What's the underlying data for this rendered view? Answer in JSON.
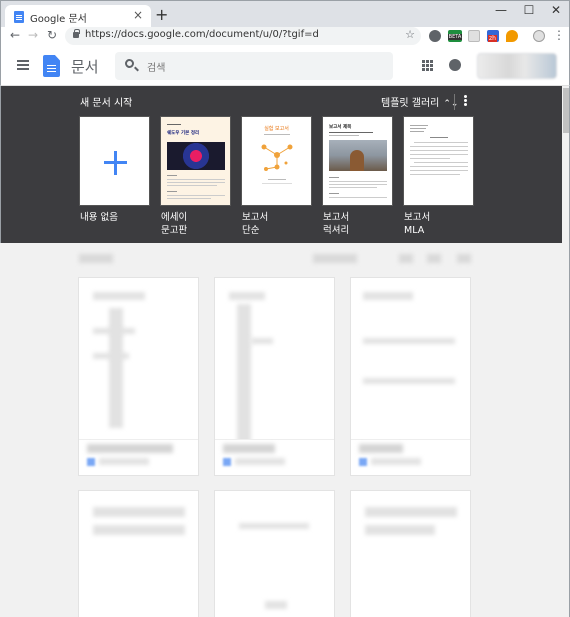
{
  "browser": {
    "tab_title": "Google 문서",
    "tab_close": "×",
    "new_tab": "+",
    "minimize": "—",
    "maximize": "☐",
    "close": "✕",
    "back": "←",
    "forward": "→",
    "reload": "↻",
    "url": "https://docs.google.com/document/u/0/?tgif=d",
    "bookmark_star": "☆",
    "menu": "⋮",
    "extensions": [
      {
        "name": "puzzle-extension-icon",
        "color": "#5f6368"
      },
      {
        "name": "beta-extension-icon",
        "color": "#1e8e3e"
      },
      {
        "name": "grid-extension-icon",
        "color": "#bdbdbd"
      },
      {
        "name": "zh-extension-icon",
        "color": "#d93025"
      },
      {
        "name": "leaf-extension-icon",
        "color": "#f29900"
      },
      {
        "name": "profile-extension-icon",
        "color": "#9e9e9e"
      }
    ],
    "beta_label": "BETA",
    "zh_label": "zh"
  },
  "header": {
    "app_name": "문서",
    "search_placeholder": "검색"
  },
  "templates": {
    "section_title": "새 문서 시작",
    "gallery_label": "템플릿 갤러리",
    "gallery_chevron": "⌃⌄",
    "items": [
      {
        "line1": "내용 없음",
        "line2": ""
      },
      {
        "line1": "에세이",
        "line2": "문고판"
      },
      {
        "line1": "보고서",
        "line2": "단순"
      },
      {
        "line1": "보고서",
        "line2": "럭셔리"
      },
      {
        "line1": "보고서",
        "line2": "MLA"
      }
    ],
    "essay_heading": "쉐도우 기본 정리",
    "report_simple_heading": "실험 보고서",
    "report_lux_heading": "보고서 제목"
  },
  "colors": {
    "accent": "#4285f4",
    "template_bg": "#3c3c3f"
  }
}
